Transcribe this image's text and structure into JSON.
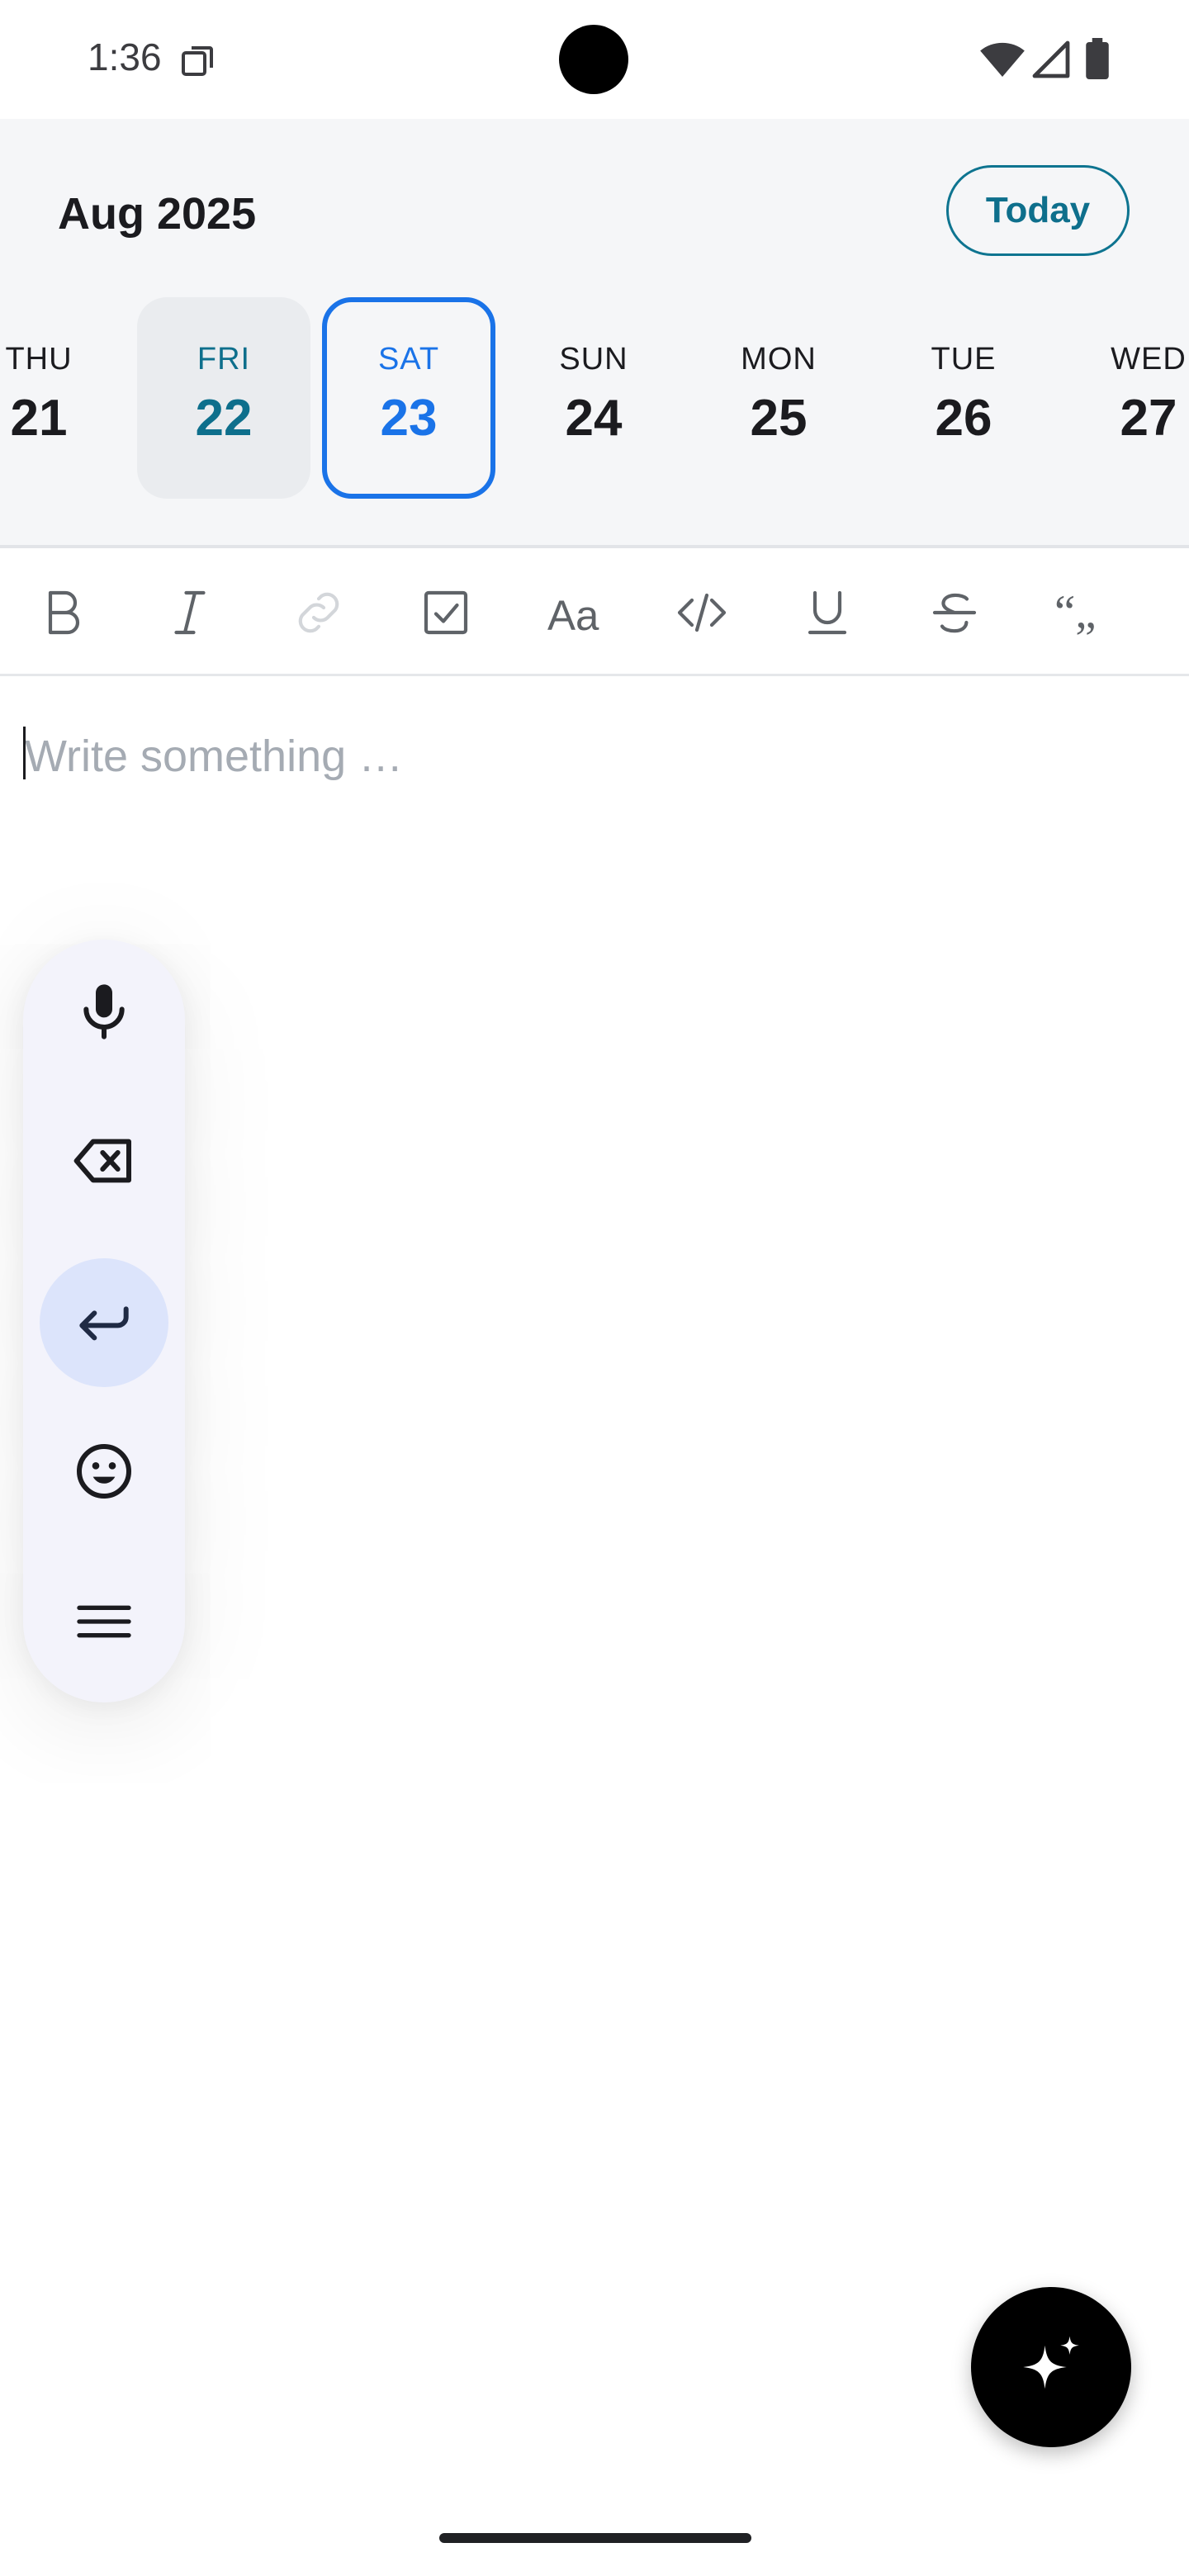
{
  "status_bar": {
    "time": "1:36"
  },
  "calendar": {
    "month_label": "Aug 2025",
    "today_label": "Today",
    "days": [
      {
        "dow": "THU",
        "num": "21",
        "state": "normal"
      },
      {
        "dow": "FRI",
        "num": "22",
        "state": "previous"
      },
      {
        "dow": "SAT",
        "num": "23",
        "state": "selected"
      },
      {
        "dow": "SUN",
        "num": "24",
        "state": "normal"
      },
      {
        "dow": "MON",
        "num": "25",
        "state": "normal"
      },
      {
        "dow": "TUE",
        "num": "26",
        "state": "normal"
      },
      {
        "dow": "WED",
        "num": "27",
        "state": "normal"
      }
    ]
  },
  "toolbar": {
    "buttons": [
      "bold-icon",
      "italic-icon",
      "link-icon",
      "checkbox-icon",
      "text-size-icon",
      "code-icon",
      "underline-icon",
      "strikethrough-icon",
      "quote-icon"
    ],
    "link_disabled": true
  },
  "editor": {
    "placeholder": "Write something …",
    "value": ""
  },
  "floating_toolbar": {
    "buttons": [
      "microphone-icon",
      "backspace-icon",
      "enter-icon",
      "emoji-icon",
      "menu-icon"
    ],
    "active": "enter-icon"
  },
  "fab": {
    "icon": "sparkle-icon"
  },
  "colors": {
    "accent_teal": "#0e6f8c",
    "selected_blue": "#1a73e8",
    "header_bg": "#f5f6f8",
    "pill_bg": "#f3f3fb",
    "pill_active": "#dce4fb"
  }
}
